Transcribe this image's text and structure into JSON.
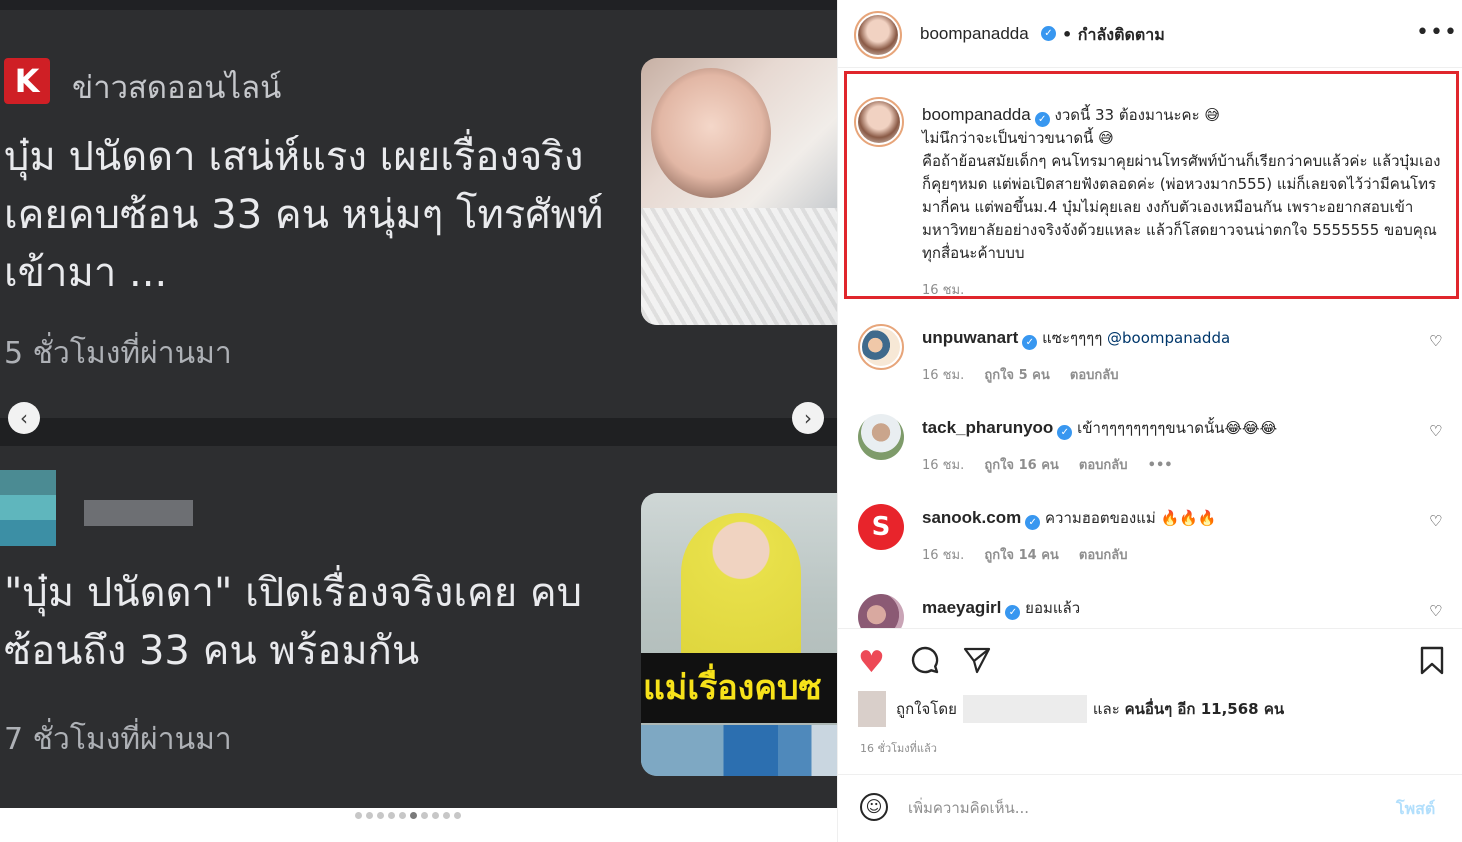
{
  "media": {
    "card1": {
      "source_logo_letter": "K",
      "source_name": "ข่าวสดออนไลน์",
      "headline": "บุ๋ม ปนัดดา เสน่ห์แรง เผยเรื่องจริง เคยคบซ้อน 33 คน หนุ่มๆ โทรศัพท์เข้ามา ...",
      "time_ago": "5 ชั่วโมงที่ผ่านมา"
    },
    "card2": {
      "headline": "\"บุ๋ม ปนัดดา\" เปิดเรื่องจริงเคย คบซ้อนถึง 33 คน พร้อมกัน",
      "time_ago": "7 ชั่วโมงที่ผ่านมา",
      "thumb_banner": "แม่เรื่องคบซ"
    },
    "nav_prev": "‹",
    "nav_next": "›",
    "carousel_dots": 10,
    "carousel_active_index": 5
  },
  "header": {
    "username": "boompanadda",
    "verified_mark": "✓",
    "follow_status": "• กำลังติดตาม",
    "more": "•••"
  },
  "caption": {
    "username": "boompanadda",
    "text_line1": "งวดนี้ 33 ต้องมานะคะ 😅",
    "text_line2": "ไม่นึกว่าจะเป็นข่าวขนาดนี้ 😅",
    "text_line3": "คือถ้าย้อนสมัยเด็กๆ คนโทรมาคุยผ่านโทรศัพท์บ้านก็เรียกว่าคบแล้วค่ะ แล้วบุ๋มเองก็คุยๆหมด แต่พ่อเปิดสายฟังตลอดค่ะ (พ่อหวงมาก555) แม่ก็เลยจดไว้ว่ามีคนโทรมากี่คน แต่พอขึ้นม.4 บุ๋มไม่คุยเลย งงกับตัวเองเหมือนกัน เพราะอยากสอบเข้ามหาวิทยาลัยอย่างจริงจังด้วยแหละ แล้วก็โสดยาวจนน่าตกใจ 5555555 ขอบคุณทุกสื่อนะค้าบบบ",
    "time": "16 ชม."
  },
  "comments": [
    {
      "username": "unpuwanart",
      "text": "แซะๆๆๆๆ ",
      "mention": "@boompanadda",
      "time": "16 ชม.",
      "likes": "ถูกใจ 5 คน",
      "reply": "ตอบกลับ",
      "extra": ""
    },
    {
      "username": "tack_pharunyoo",
      "text": "เข้าๆๆๆๆๆๆๆๆขนาดนั้น😂😂😂",
      "mention": "",
      "time": "16 ชม.",
      "likes": "ถูกใจ 16 คน",
      "reply": "ตอบกลับ",
      "extra": "•••"
    },
    {
      "username": "sanook.com",
      "text": "ความฮอตของแม่ 🔥🔥🔥",
      "mention": "",
      "time": "16 ชม.",
      "likes": "ถูกใจ 14 คน",
      "reply": "ตอบกลับ",
      "extra": ""
    },
    {
      "username": "maeyagirl",
      "text": "ยอมแล้ว",
      "mention": "",
      "time": "",
      "likes": "",
      "reply": "",
      "extra": ""
    }
  ],
  "comment_heart": "♡",
  "actions": {
    "like_icon": "heart-icon",
    "comment_icon": "comment-icon",
    "share_icon": "share-icon",
    "save_icon": "bookmark-icon",
    "liked_by_prefix": "ถูกใจโดย",
    "liked_by_suffix": "และ",
    "liked_by_others": "คนอื่นๆ อีก 11,568 คน",
    "post_time": "16 ชั่วโมงที่แล้ว"
  },
  "add_comment": {
    "placeholder": "เพิ่มความคิดเห็น...",
    "post_label": "โพสต์"
  },
  "colors": {
    "highlight_border": "#e0262c",
    "like_red": "#ed4956",
    "verified_blue": "#3897f0",
    "post_button": "#b2dffc"
  }
}
